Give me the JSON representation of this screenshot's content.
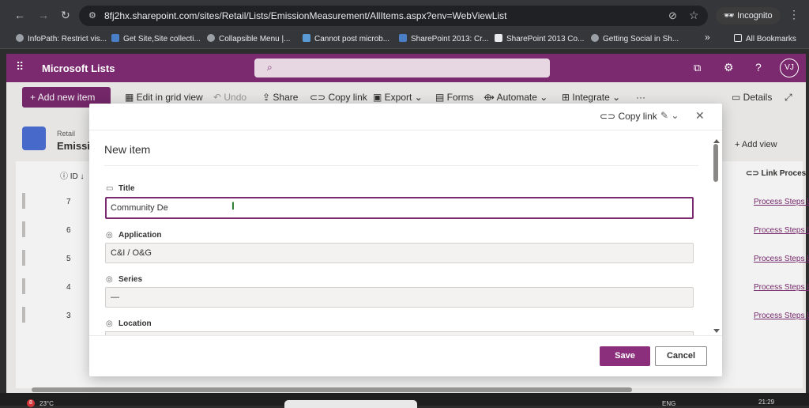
{
  "browser": {
    "url": "8fj2hx.sharepoint.com/sites/Retail/Lists/EmissionMeasurement/AllItems.aspx?env=WebViewList",
    "incognito_label": "Incognito",
    "bookmarks": [
      "InfoPath: Restrict vis...",
      "Get Site,Site collecti...",
      "Collapsible Menu |...",
      "Cannot post microb...",
      "SharePoint 2013: Cr...",
      "SharePoint 2013 Co...",
      "Getting Social in Sh..."
    ],
    "all_bookmarks_label": "All Bookmarks"
  },
  "suite": {
    "app_title": "Microsoft Lists",
    "avatar_initials": "VJ"
  },
  "commands": {
    "new_item": "Add new item",
    "grid_view": "Edit in grid view",
    "undo": "Undo",
    "share": "Share",
    "copy_link": "Copy link",
    "export": "Export",
    "forms": "Forms",
    "automate": "Automate",
    "integrate": "Integrate",
    "more": "···",
    "details": "Details"
  },
  "list": {
    "site": "Retail",
    "title_partial": "Emissi",
    "add_view": "Add view",
    "id_header": "ID",
    "link_header": "Link Proces",
    "rows": [
      {
        "id": "7",
        "link": "Process Steps L"
      },
      {
        "id": "6",
        "link": "Process Steps L"
      },
      {
        "id": "5",
        "link": "Process Steps L"
      },
      {
        "id": "4",
        "link": "Process Steps L"
      },
      {
        "id": "3",
        "link": "Process Steps L"
      }
    ]
  },
  "dialog": {
    "copy_link": "Copy link",
    "title": "New item",
    "fields": {
      "title_label": "Title",
      "title_value": "Community De",
      "application_label": "Application",
      "application_value": "C&I / O&G",
      "series_label": "Series",
      "series_value": "—",
      "location_label": "Location"
    },
    "save_label": "Save",
    "cancel_label": "Cancel"
  },
  "taskbar": {
    "temp": "23°C",
    "lang": "ENG",
    "time": "21:29",
    "badge": "8"
  },
  "colors": {
    "brand": "#7b2a6f",
    "save": "#8b2f7d"
  }
}
